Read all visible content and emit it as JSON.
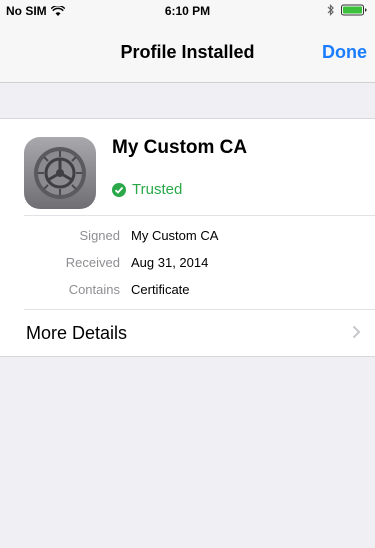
{
  "status": {
    "carrier": "No SIM",
    "time": "6:10 PM"
  },
  "nav": {
    "title": "Profile Installed",
    "done": "Done"
  },
  "profile": {
    "name": "My Custom CA",
    "status": "Trusted"
  },
  "details": [
    {
      "label": "Signed",
      "value": "My Custom CA"
    },
    {
      "label": "Received",
      "value": "Aug 31, 2014"
    },
    {
      "label": "Contains",
      "value": "Certificate"
    }
  ],
  "more": {
    "label": "More Details"
  },
  "colors": {
    "accent": "#1a7cff",
    "trusted": "#2aa84a",
    "background": "#efeff4"
  },
  "icons": [
    "wifi-icon",
    "bluetooth-icon",
    "battery-icon",
    "settings-gear-icon",
    "check-icon",
    "chevron-right-icon"
  ]
}
